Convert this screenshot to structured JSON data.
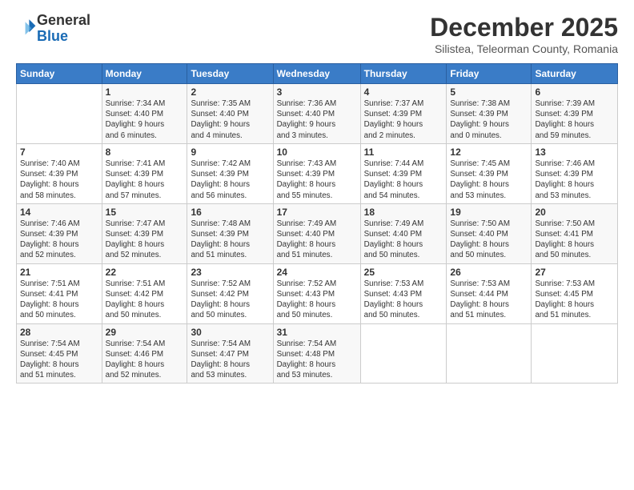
{
  "logo": {
    "general": "General",
    "blue": "Blue"
  },
  "header": {
    "month_year": "December 2025",
    "location": "Silistea, Teleorman County, Romania"
  },
  "weekdays": [
    "Sunday",
    "Monday",
    "Tuesday",
    "Wednesday",
    "Thursday",
    "Friday",
    "Saturday"
  ],
  "weeks": [
    [
      {
        "day": "",
        "info": ""
      },
      {
        "day": "1",
        "info": "Sunrise: 7:34 AM\nSunset: 4:40 PM\nDaylight: 9 hours\nand 6 minutes."
      },
      {
        "day": "2",
        "info": "Sunrise: 7:35 AM\nSunset: 4:40 PM\nDaylight: 9 hours\nand 4 minutes."
      },
      {
        "day": "3",
        "info": "Sunrise: 7:36 AM\nSunset: 4:40 PM\nDaylight: 9 hours\nand 3 minutes."
      },
      {
        "day": "4",
        "info": "Sunrise: 7:37 AM\nSunset: 4:39 PM\nDaylight: 9 hours\nand 2 minutes."
      },
      {
        "day": "5",
        "info": "Sunrise: 7:38 AM\nSunset: 4:39 PM\nDaylight: 9 hours\nand 0 minutes."
      },
      {
        "day": "6",
        "info": "Sunrise: 7:39 AM\nSunset: 4:39 PM\nDaylight: 8 hours\nand 59 minutes."
      }
    ],
    [
      {
        "day": "7",
        "info": "Sunrise: 7:40 AM\nSunset: 4:39 PM\nDaylight: 8 hours\nand 58 minutes."
      },
      {
        "day": "8",
        "info": "Sunrise: 7:41 AM\nSunset: 4:39 PM\nDaylight: 8 hours\nand 57 minutes."
      },
      {
        "day": "9",
        "info": "Sunrise: 7:42 AM\nSunset: 4:39 PM\nDaylight: 8 hours\nand 56 minutes."
      },
      {
        "day": "10",
        "info": "Sunrise: 7:43 AM\nSunset: 4:39 PM\nDaylight: 8 hours\nand 55 minutes."
      },
      {
        "day": "11",
        "info": "Sunrise: 7:44 AM\nSunset: 4:39 PM\nDaylight: 8 hours\nand 54 minutes."
      },
      {
        "day": "12",
        "info": "Sunrise: 7:45 AM\nSunset: 4:39 PM\nDaylight: 8 hours\nand 53 minutes."
      },
      {
        "day": "13",
        "info": "Sunrise: 7:46 AM\nSunset: 4:39 PM\nDaylight: 8 hours\nand 53 minutes."
      }
    ],
    [
      {
        "day": "14",
        "info": "Sunrise: 7:46 AM\nSunset: 4:39 PM\nDaylight: 8 hours\nand 52 minutes."
      },
      {
        "day": "15",
        "info": "Sunrise: 7:47 AM\nSunset: 4:39 PM\nDaylight: 8 hours\nand 52 minutes."
      },
      {
        "day": "16",
        "info": "Sunrise: 7:48 AM\nSunset: 4:39 PM\nDaylight: 8 hours\nand 51 minutes."
      },
      {
        "day": "17",
        "info": "Sunrise: 7:49 AM\nSunset: 4:40 PM\nDaylight: 8 hours\nand 51 minutes."
      },
      {
        "day": "18",
        "info": "Sunrise: 7:49 AM\nSunset: 4:40 PM\nDaylight: 8 hours\nand 50 minutes."
      },
      {
        "day": "19",
        "info": "Sunrise: 7:50 AM\nSunset: 4:40 PM\nDaylight: 8 hours\nand 50 minutes."
      },
      {
        "day": "20",
        "info": "Sunrise: 7:50 AM\nSunset: 4:41 PM\nDaylight: 8 hours\nand 50 minutes."
      }
    ],
    [
      {
        "day": "21",
        "info": "Sunrise: 7:51 AM\nSunset: 4:41 PM\nDaylight: 8 hours\nand 50 minutes."
      },
      {
        "day": "22",
        "info": "Sunrise: 7:51 AM\nSunset: 4:42 PM\nDaylight: 8 hours\nand 50 minutes."
      },
      {
        "day": "23",
        "info": "Sunrise: 7:52 AM\nSunset: 4:42 PM\nDaylight: 8 hours\nand 50 minutes."
      },
      {
        "day": "24",
        "info": "Sunrise: 7:52 AM\nSunset: 4:43 PM\nDaylight: 8 hours\nand 50 minutes."
      },
      {
        "day": "25",
        "info": "Sunrise: 7:53 AM\nSunset: 4:43 PM\nDaylight: 8 hours\nand 50 minutes."
      },
      {
        "day": "26",
        "info": "Sunrise: 7:53 AM\nSunset: 4:44 PM\nDaylight: 8 hours\nand 51 minutes."
      },
      {
        "day": "27",
        "info": "Sunrise: 7:53 AM\nSunset: 4:45 PM\nDaylight: 8 hours\nand 51 minutes."
      }
    ],
    [
      {
        "day": "28",
        "info": "Sunrise: 7:54 AM\nSunset: 4:45 PM\nDaylight: 8 hours\nand 51 minutes."
      },
      {
        "day": "29",
        "info": "Sunrise: 7:54 AM\nSunset: 4:46 PM\nDaylight: 8 hours\nand 52 minutes."
      },
      {
        "day": "30",
        "info": "Sunrise: 7:54 AM\nSunset: 4:47 PM\nDaylight: 8 hours\nand 53 minutes."
      },
      {
        "day": "31",
        "info": "Sunrise: 7:54 AM\nSunset: 4:48 PM\nDaylight: 8 hours\nand 53 minutes."
      },
      {
        "day": "",
        "info": ""
      },
      {
        "day": "",
        "info": ""
      },
      {
        "day": "",
        "info": ""
      }
    ]
  ]
}
